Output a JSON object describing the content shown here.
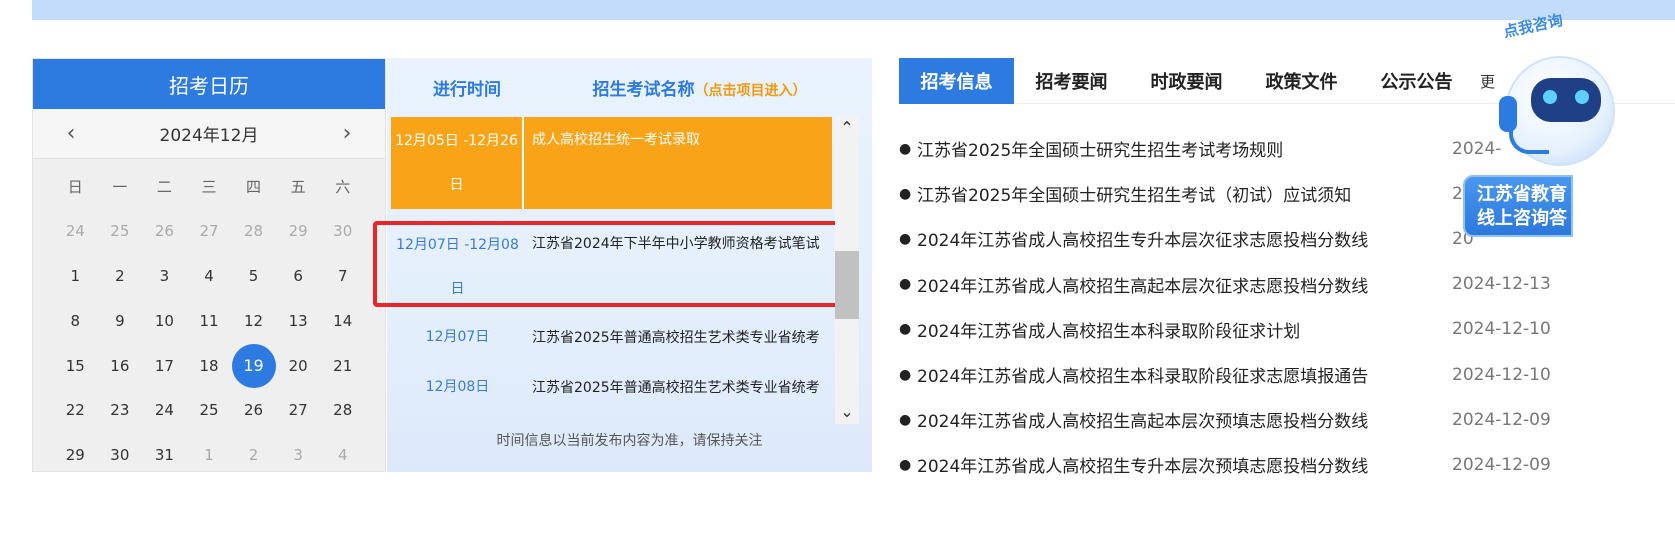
{
  "calendar": {
    "title": "招考日历",
    "month_label": "2024年12月",
    "prev_icon": "chevron-left-icon",
    "next_icon": "chevron-right-icon",
    "weekdays": [
      "日",
      "一",
      "二",
      "三",
      "四",
      "五",
      "六"
    ],
    "days": [
      {
        "d": "24",
        "muted": true
      },
      {
        "d": "25",
        "muted": true
      },
      {
        "d": "26",
        "muted": true
      },
      {
        "d": "27",
        "muted": true
      },
      {
        "d": "28",
        "muted": true
      },
      {
        "d": "29",
        "muted": true
      },
      {
        "d": "30",
        "muted": true
      },
      {
        "d": "1"
      },
      {
        "d": "2"
      },
      {
        "d": "3"
      },
      {
        "d": "4"
      },
      {
        "d": "5"
      },
      {
        "d": "6"
      },
      {
        "d": "7"
      },
      {
        "d": "8"
      },
      {
        "d": "9"
      },
      {
        "d": "10"
      },
      {
        "d": "11"
      },
      {
        "d": "12"
      },
      {
        "d": "13"
      },
      {
        "d": "14"
      },
      {
        "d": "15"
      },
      {
        "d": "16"
      },
      {
        "d": "17"
      },
      {
        "d": "18"
      },
      {
        "d": "19",
        "today": true
      },
      {
        "d": "20"
      },
      {
        "d": "21"
      },
      {
        "d": "22"
      },
      {
        "d": "23"
      },
      {
        "d": "24"
      },
      {
        "d": "25"
      },
      {
        "d": "26"
      },
      {
        "d": "27"
      },
      {
        "d": "28"
      },
      {
        "d": "29"
      },
      {
        "d": "30"
      },
      {
        "d": "31"
      },
      {
        "d": "1",
        "muted": true
      },
      {
        "d": "2",
        "muted": true
      },
      {
        "d": "3",
        "muted": true
      },
      {
        "d": "4",
        "muted": true
      }
    ]
  },
  "schedule": {
    "head_time": "进行时间",
    "head_name": "招生考试名称",
    "head_hint": "（点击项目进入）",
    "rows": [
      {
        "time": "12月05日 -12月26日",
        "name": "成人高校招生统一考试录取"
      },
      {
        "time": "12月07日 -12月08日",
        "name": "江苏省2024年下半年中小学教师资格考试笔试"
      },
      {
        "time": "12月07日",
        "name": "江苏省2025年普通高校招生艺术类专业省统考"
      },
      {
        "time": "12月08日",
        "name": "江苏省2025年普通高校招生艺术类专业省统考"
      }
    ],
    "note": "时间信息以当前发布内容为准，请保持关注"
  },
  "news": {
    "tabs": [
      "招考信息",
      "招考要闻",
      "时政要闻",
      "政策文件",
      "公示公告"
    ],
    "more_label": "更",
    "items": [
      {
        "title": "江苏省2025年全国硕士研究生招生考试考场规则",
        "date": "2024-"
      },
      {
        "title": "江苏省2025年全国硕士研究生招生考试（初试）应试须知",
        "date": "2"
      },
      {
        "title": "2024年江苏省成人高校招生专升本层次征求志愿投档分数线",
        "date": "20"
      },
      {
        "title": "2024年江苏省成人高校招生高起本层次征求志愿投档分数线",
        "date": "2024-12-13"
      },
      {
        "title": "2024年江苏省成人高校招生本科录取阶段征求计划",
        "date": "2024-12-10"
      },
      {
        "title": "2024年江苏省成人高校招生本科录取阶段征求志愿填报通告",
        "date": "2024-12-10"
      },
      {
        "title": "2024年江苏省成人高校招生高起本层次预填志愿投档分数线",
        "date": "2024-12-09"
      },
      {
        "title": "2024年江苏省成人高校招生专升本层次预填志愿投档分数线",
        "date": "2024-12-09"
      }
    ]
  },
  "robot": {
    "bubble": "点我咨询",
    "label_line1": "江苏省教育",
    "label_line2": "线上咨询答"
  }
}
